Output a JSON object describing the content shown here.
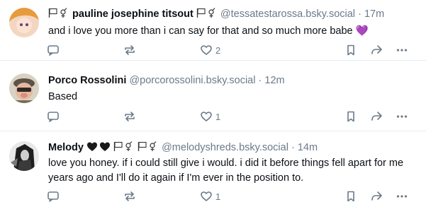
{
  "posts": [
    {
      "display_name": "pauline josephine titsout",
      "handle": "@tessatestarossa.bsky.social",
      "separator": "·",
      "time": "17m",
      "text": "and i love you more than i can say for that and so much more babe",
      "emoji": "💜",
      "likes": "2"
    },
    {
      "display_name": "Porco Rossolini",
      "handle": "@porcorossolini.bsky.social",
      "separator": "·",
      "time": "12m",
      "text": "Based",
      "likes": "1"
    },
    {
      "display_name": "Melody",
      "handle": "@melodyshreds.bsky.social",
      "separator": "·",
      "time": "14m",
      "text": "love you honey. if i could still give i would. i did it before things fell apart for me years ago and I'll do it again if I'm ever in the position to.",
      "likes": "1"
    }
  ],
  "icons": {
    "reply": "reply-icon",
    "repost": "repost-icon",
    "like": "heart-icon",
    "bookmark": "bookmark-icon",
    "share": "share-icon",
    "more": "more-icon"
  },
  "colors": {
    "muted": "#6b7a8a",
    "text": "#0b0f14",
    "heart_emoji": "#8a4fd8",
    "divider": "#e6ebf0"
  }
}
